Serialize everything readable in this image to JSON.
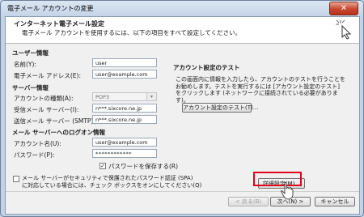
{
  "window": {
    "title": "電子メール アカウントの変更",
    "close_label": "✕"
  },
  "header": {
    "title": "インターネット電子メール設定",
    "subtitle": "電子メール アカウントを使用するには、以下の項目をすべて設定してください。"
  },
  "user_info": {
    "section": "ユーザー情報",
    "name_label": "名前(Y):",
    "name_value": "user",
    "email_label": "電子メール アドレス(E):",
    "email_value": "user@example.com"
  },
  "server_info": {
    "section": "サーバー情報",
    "account_type_label": "アカウントの種類(A):",
    "account_type_value": "POP3",
    "incoming_label": "受信メール サーバー(I):",
    "incoming_value": "n***.sixcore.ne.jp",
    "outgoing_label": "送信メール サーバー (SMTP)(O):",
    "outgoing_value": "n***.sixcore.ne.jp"
  },
  "logon_info": {
    "section": "メール サーバーへのログオン情報",
    "account_label": "アカウント名(U):",
    "account_value": "user@example.com",
    "password_label": "パスワード(P):",
    "password_value": "************",
    "save_password_label": "パスワードを保存する(R)",
    "spa_label_line1": "メール サーバーがセキュリティで保護されたパスワード認証 (SPA)",
    "spa_label_line2": "に対応している場合には、チェック ボックスをオンにしてください(Q)"
  },
  "test": {
    "section": "アカウント設定のテスト",
    "description": "この画面内に情報を入力したら、アカウントのテストを行うことをお勧めします。テストを実行するには [アカウント設定のテスト] をクリックします (ネットワークに接続されている必要があります)。",
    "test_button": "アカウント設定のテスト(T)..."
  },
  "buttons": {
    "more_settings": "詳細設定(M)...",
    "back": "< 戻る(B)",
    "next": "次へ(N) >",
    "cancel": "キャンセル"
  },
  "checkboxes": {
    "save_password": true,
    "spa": false
  },
  "colors": {
    "highlight": "#e3001b",
    "title_close": "#c8442e"
  }
}
